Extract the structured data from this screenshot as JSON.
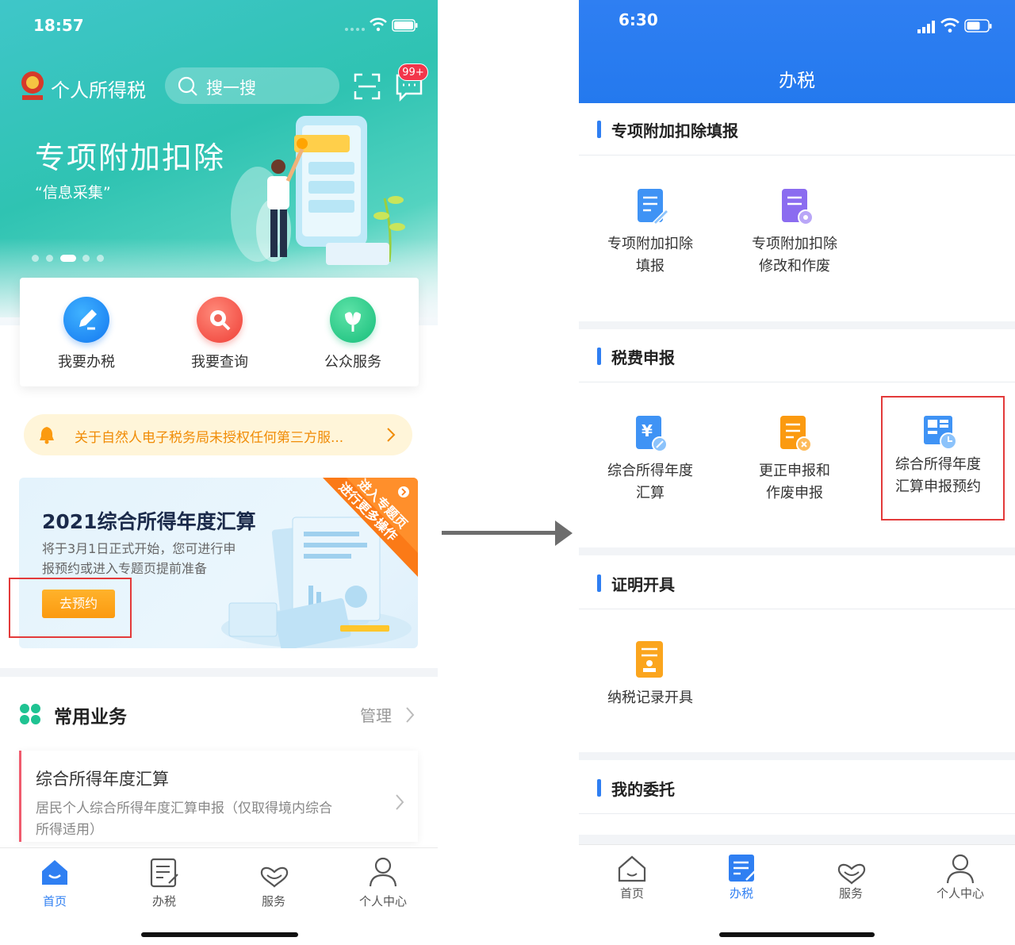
{
  "left": {
    "status_time": "18:57",
    "app_title": "个人所得税",
    "search_placeholder": "搜一搜",
    "message_badge": "99+",
    "hero_title": "专项附加扣除",
    "hero_subtitle": "“信息采集”",
    "quick_actions": [
      {
        "label": "我要办税"
      },
      {
        "label": "我要查询"
      },
      {
        "label": "公众服务"
      }
    ],
    "notice_text": "关于自然人电子税务局未授权任何第三方服...",
    "banner": {
      "title": "2021综合所得年度汇算",
      "desc_line1": "将于3月1日正式开始，您可进行申",
      "desc_line2": "报预约或进入专题页提前准备",
      "button": "去预约",
      "corner_line1": "进入专题页",
      "corner_line2": "进行更多操作"
    },
    "common": {
      "title": "常用业务",
      "manage": "管理",
      "item_title": "综合所得年度汇算",
      "item_desc_line1": "居民个人综合所得年度汇算申报（仅取得境内综合",
      "item_desc_line2": "所得适用）"
    },
    "tabs": [
      {
        "label": "首页"
      },
      {
        "label": "办税"
      },
      {
        "label": "服务"
      },
      {
        "label": "个人中心"
      }
    ]
  },
  "right": {
    "status_time": "6:30",
    "title": "办税",
    "sections": [
      {
        "title": "专项附加扣除填报",
        "items": [
          {
            "line1": "专项附加扣除",
            "line2": "填报"
          },
          {
            "line1": "专项附加扣除",
            "line2": "修改和作废"
          }
        ]
      },
      {
        "title": "税费申报",
        "items": [
          {
            "line1": "综合所得年度",
            "line2": "汇算"
          },
          {
            "line1": "更正申报和",
            "line2": "作废申报"
          },
          {
            "line1": "综合所得年度",
            "line2": "汇算申报预约"
          }
        ]
      },
      {
        "title": "证明开具",
        "items": [
          {
            "line1": "纳税记录开具"
          }
        ]
      },
      {
        "title": "我的委托",
        "items": []
      }
    ],
    "tabs": [
      {
        "label": "首页"
      },
      {
        "label": "办税"
      },
      {
        "label": "服务"
      },
      {
        "label": "个人中心"
      }
    ]
  },
  "colors": {
    "hero_teal": "#2fc3b2",
    "primary_blue": "#2f7ff2",
    "orange": "#fb9a10",
    "highlight_red": "#e33a3a"
  }
}
